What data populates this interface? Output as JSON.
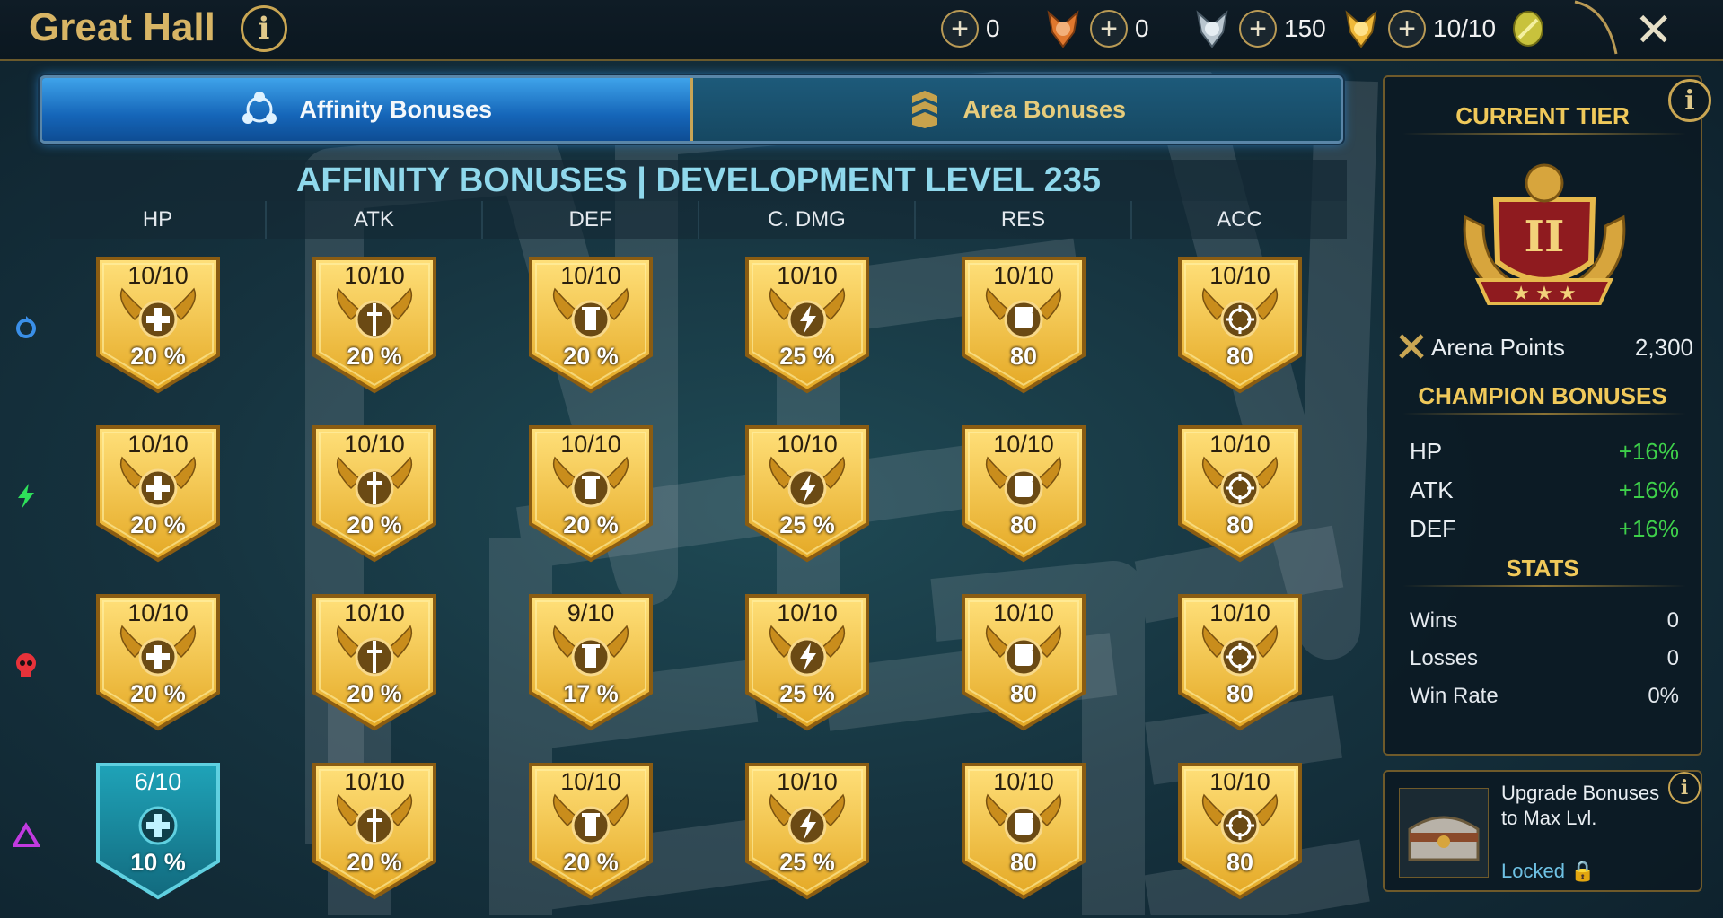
{
  "header": {
    "title": "Great Hall",
    "info_icon": "info-icon",
    "close_icon": "close-icon",
    "resources": [
      {
        "name": "bronze-medal",
        "value": "0",
        "color": "#e0782e"
      },
      {
        "name": "silver-medal",
        "value": "0",
        "color": "#b9c6cf"
      },
      {
        "name": "gold-medal",
        "value": "150",
        "color": "#f0b93a"
      },
      {
        "name": "arena-token",
        "value": "10/10",
        "color": "#c8c23c"
      }
    ]
  },
  "tabs": [
    {
      "label": "Affinity Bonuses",
      "active": true,
      "icon": "affinity-icon"
    },
    {
      "label": "Area Bonuses",
      "active": false,
      "icon": "area-icon"
    }
  ],
  "board": {
    "title": "AFFINITY BONUSES | DEVELOPMENT LEVEL 235",
    "columns": [
      "HP",
      "ATK",
      "DEF",
      "C. DMG",
      "RES",
      "ACC"
    ],
    "rows": [
      {
        "affinity": "magic",
        "color": "#3a8fe8",
        "cells": [
          {
            "level": "10/10",
            "value": "20 %"
          },
          {
            "level": "10/10",
            "value": "20 %"
          },
          {
            "level": "10/10",
            "value": "20 %"
          },
          {
            "level": "10/10",
            "value": "25 %"
          },
          {
            "level": "10/10",
            "value": "80"
          },
          {
            "level": "10/10",
            "value": "80"
          }
        ]
      },
      {
        "affinity": "force",
        "color": "#2ee05a",
        "cells": [
          {
            "level": "10/10",
            "value": "20 %"
          },
          {
            "level": "10/10",
            "value": "20 %"
          },
          {
            "level": "10/10",
            "value": "20 %"
          },
          {
            "level": "10/10",
            "value": "25 %"
          },
          {
            "level": "10/10",
            "value": "80"
          },
          {
            "level": "10/10",
            "value": "80"
          }
        ]
      },
      {
        "affinity": "spirit",
        "color": "#e8323a",
        "cells": [
          {
            "level": "10/10",
            "value": "20 %"
          },
          {
            "level": "10/10",
            "value": "20 %"
          },
          {
            "level": "9/10",
            "value": "17 %"
          },
          {
            "level": "10/10",
            "value": "25 %"
          },
          {
            "level": "10/10",
            "value": "80"
          },
          {
            "level": "10/10",
            "value": "80"
          }
        ]
      },
      {
        "affinity": "void",
        "color": "#c23ae0",
        "cells": [
          {
            "level": "6/10",
            "value": "10 %",
            "incomplete": true
          },
          {
            "level": "10/10",
            "value": "20 %"
          },
          {
            "level": "10/10",
            "value": "20 %"
          },
          {
            "level": "10/10",
            "value": "25 %"
          },
          {
            "level": "10/10",
            "value": "80"
          },
          {
            "level": "10/10",
            "value": "80"
          }
        ]
      }
    ]
  },
  "panel": {
    "current_tier_label": "CURRENT TIER",
    "tier_numeral": "II",
    "arena_points_label": "Arena Points",
    "arena_points_value": "2,300",
    "champion_bonuses_label": "CHAMPION BONUSES",
    "champion_bonuses": [
      {
        "stat": "HP",
        "value": "+16%"
      },
      {
        "stat": "ATK",
        "value": "+16%"
      },
      {
        "stat": "DEF",
        "value": "+16%"
      }
    ],
    "stats_label": "STATS",
    "stats": [
      {
        "label": "Wins",
        "value": "0"
      },
      {
        "label": "Losses",
        "value": "0"
      },
      {
        "label": "Win Rate",
        "value": "0%"
      }
    ]
  },
  "upgrade": {
    "text": "Upgrade Bonuses to Max Lvl.",
    "status": "Locked"
  }
}
